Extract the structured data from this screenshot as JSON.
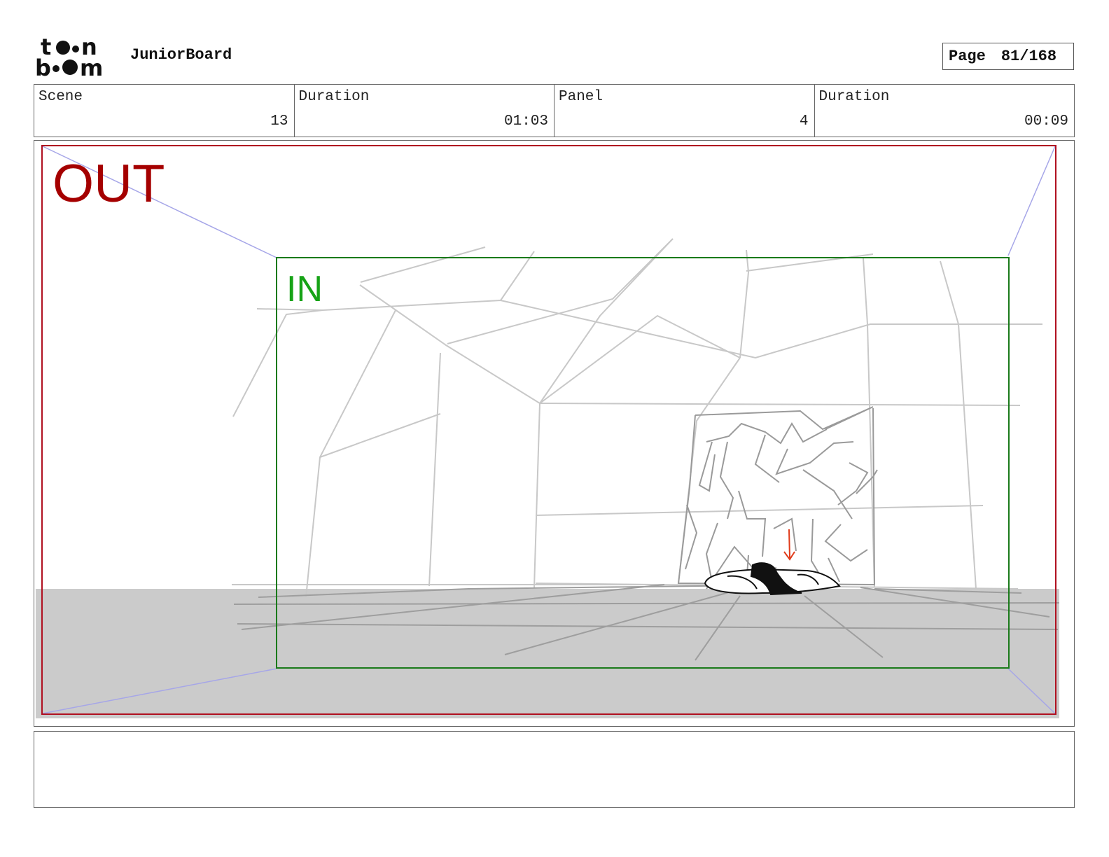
{
  "header": {
    "logo_text_top": "toon",
    "logo_text_bottom": "boom",
    "app_name": "JuniorBoard",
    "page_label": "Page",
    "page_value": "81/168"
  },
  "info": [
    {
      "label": "Scene",
      "value": "13"
    },
    {
      "label": "Duration",
      "value": "01:03"
    },
    {
      "label": "Panel",
      "value": "4"
    },
    {
      "label": "Duration",
      "value": "00:09"
    }
  ],
  "panel": {
    "out_label": "OUT",
    "in_label": "IN",
    "colors": {
      "out_frame": "#b01020",
      "in_frame": "#1a7a1a",
      "camera_guides": "#a6a6e8",
      "sketch_lines": "#c8c8c8",
      "floor": "#cbcbcb",
      "motion_arrow": "#e03b1a"
    }
  },
  "notes": {
    "text": ""
  }
}
